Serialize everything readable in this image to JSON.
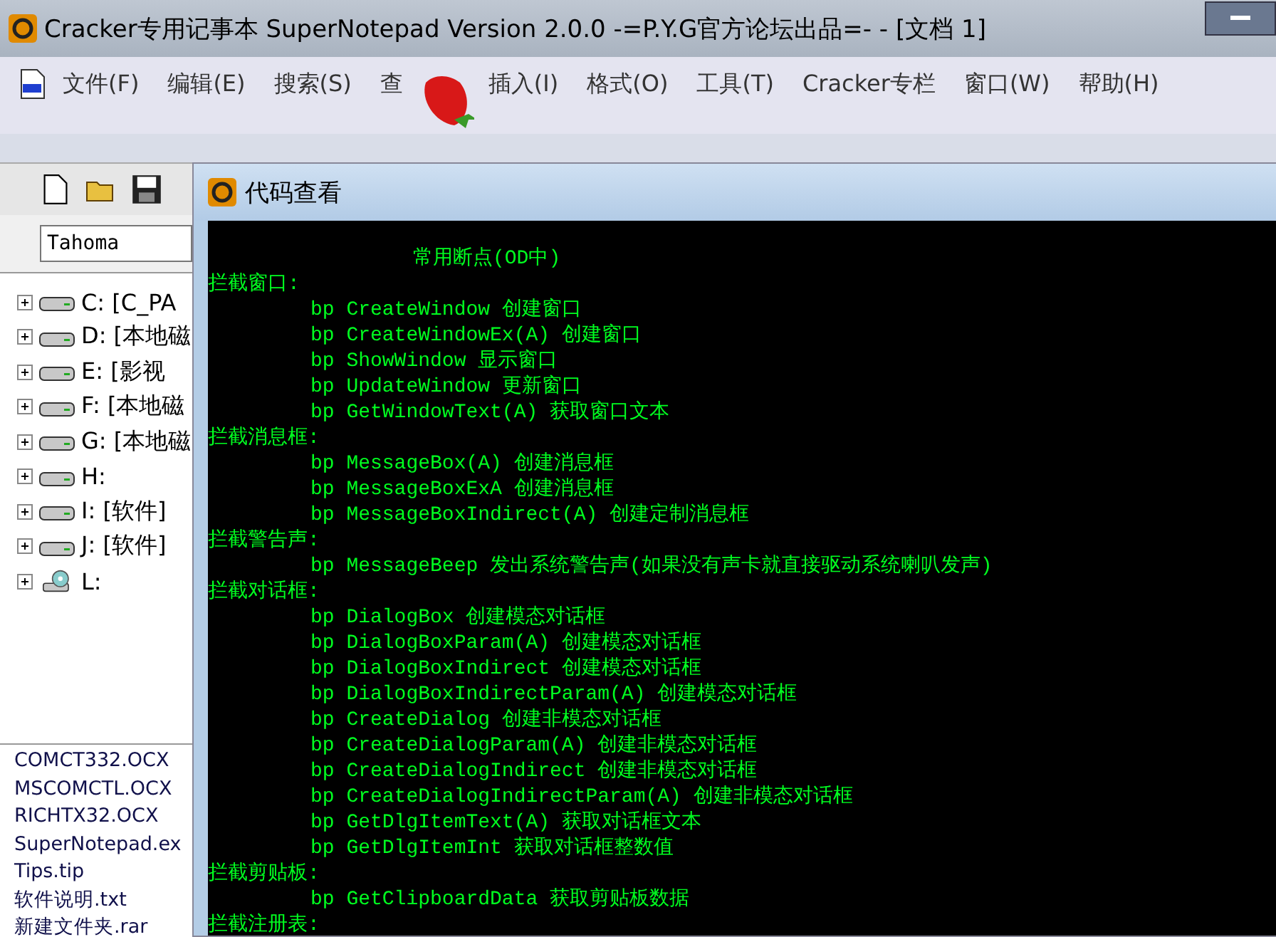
{
  "window": {
    "title": "Cracker专用记事本 SuperNotepad Version 2.0.0 -=P.Y.G官方论坛出品=- - [文档 1]"
  },
  "menu": [
    "文件(F)",
    "编辑(E)",
    "搜索(S)",
    "查",
    "插入(I)",
    "格式(O)",
    "工具(T)",
    "Cracker专栏",
    "窗口(W)",
    "帮助(H)"
  ],
  "font_box": {
    "value": "Tahoma"
  },
  "drives": [
    {
      "label": "C: [C_PA",
      "kind": "disk"
    },
    {
      "label": "D: [本地磁",
      "kind": "disk"
    },
    {
      "label": "E: [影视",
      "kind": "disk"
    },
    {
      "label": "F: [本地磁",
      "kind": "disk"
    },
    {
      "label": "G: [本地磁",
      "kind": "disk"
    },
    {
      "label": "H:",
      "kind": "disk"
    },
    {
      "label": "I: [软件]",
      "kind": "disk"
    },
    {
      "label": "J: [软件]",
      "kind": "disk"
    },
    {
      "label": "L:",
      "kind": "cdrom"
    }
  ],
  "files": [
    "COMCT332.OCX",
    "MSCOMCTL.OCX",
    "RICHTX32.OCX",
    "SuperNotepad.ex",
    "Tips.tip",
    "软件说明.txt",
    "新建文件夹.rar"
  ],
  "child_window": {
    "title": "代码查看"
  },
  "code_lines": [
    {
      "kind": "title",
      "text": "常用断点(OD中)"
    },
    {
      "kind": "section",
      "text": "拦截窗口:"
    },
    {
      "kind": "entry",
      "text": "bp CreateWindow 创建窗口"
    },
    {
      "kind": "entry",
      "text": "bp CreateWindowEx(A) 创建窗口"
    },
    {
      "kind": "entry",
      "text": "bp ShowWindow 显示窗口"
    },
    {
      "kind": "entry",
      "text": "bp UpdateWindow 更新窗口"
    },
    {
      "kind": "entry",
      "text": "bp GetWindowText(A) 获取窗口文本"
    },
    {
      "kind": "section",
      "text": "拦截消息框:"
    },
    {
      "kind": "entry",
      "text": "bp MessageBox(A) 创建消息框"
    },
    {
      "kind": "entry",
      "text": "bp MessageBoxExA 创建消息框"
    },
    {
      "kind": "entry",
      "text": "bp MessageBoxIndirect(A) 创建定制消息框"
    },
    {
      "kind": "section",
      "text": "拦截警告声:"
    },
    {
      "kind": "entry",
      "text": "bp MessageBeep 发出系统警告声(如果没有声卡就直接驱动系统喇叭发声)"
    },
    {
      "kind": "section",
      "text": "拦截对话框:"
    },
    {
      "kind": "entry",
      "text": "bp DialogBox 创建模态对话框"
    },
    {
      "kind": "entry",
      "text": "bp DialogBoxParam(A) 创建模态对话框"
    },
    {
      "kind": "entry",
      "text": "bp DialogBoxIndirect 创建模态对话框"
    },
    {
      "kind": "entry",
      "text": "bp DialogBoxIndirectParam(A) 创建模态对话框"
    },
    {
      "kind": "entry",
      "text": "bp CreateDialog 创建非模态对话框"
    },
    {
      "kind": "entry",
      "text": "bp CreateDialogParam(A) 创建非模态对话框"
    },
    {
      "kind": "entry",
      "text": "bp CreateDialogIndirect 创建非模态对话框"
    },
    {
      "kind": "entry",
      "text": "bp CreateDialogIndirectParam(A) 创建非模态对话框"
    },
    {
      "kind": "entry",
      "text": "bp GetDlgItemText(A) 获取对话框文本"
    },
    {
      "kind": "entry",
      "text": "bp GetDlgItemInt 获取对话框整数值"
    },
    {
      "kind": "section",
      "text": "拦截剪贴板:"
    },
    {
      "kind": "entry",
      "text": "bp GetClipboardData 获取剪贴板数据"
    },
    {
      "kind": "section",
      "text": "拦截注册表:"
    }
  ]
}
